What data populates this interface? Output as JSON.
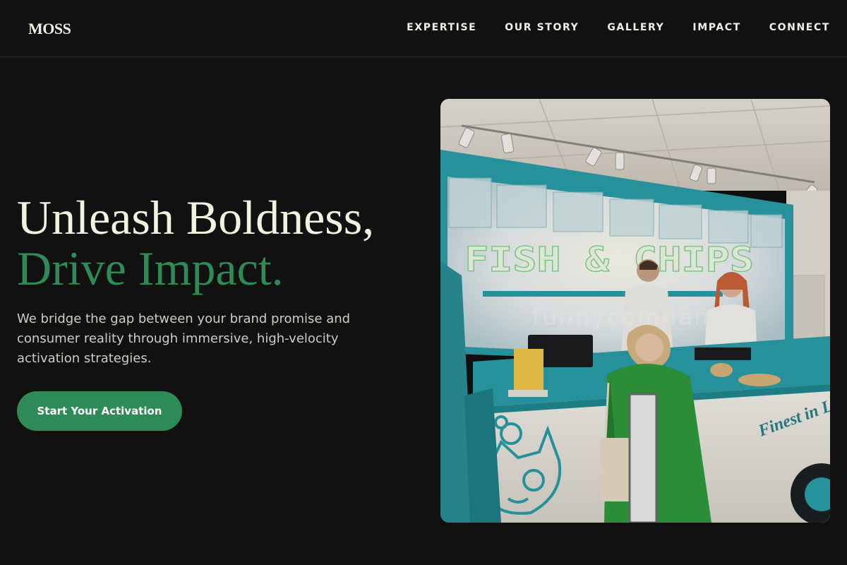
{
  "header": {
    "logo": "MOSS",
    "nav": [
      "EXPERTISE",
      "OUR STORY",
      "GALLERY",
      "IMPACT",
      "CONNECT"
    ]
  },
  "hero": {
    "title_line1": "Unleash Boldness,",
    "title_line2": "Drive Impact.",
    "description": "We bridge the gap between your brand promise and consumer reality through immersive, high-velocity activation strategies.",
    "cta_label": "Start Your Activation",
    "image": {
      "sign_text": "FISH & CHIPS",
      "counter_text": "Finest in London",
      "watermark": "funnycomilanz"
    }
  },
  "colors": {
    "background": "#111111",
    "accent": "#2e8b57",
    "heading": "#f3f1e0",
    "body_text": "#cfcdc2",
    "teal": "#2a9ea8"
  }
}
